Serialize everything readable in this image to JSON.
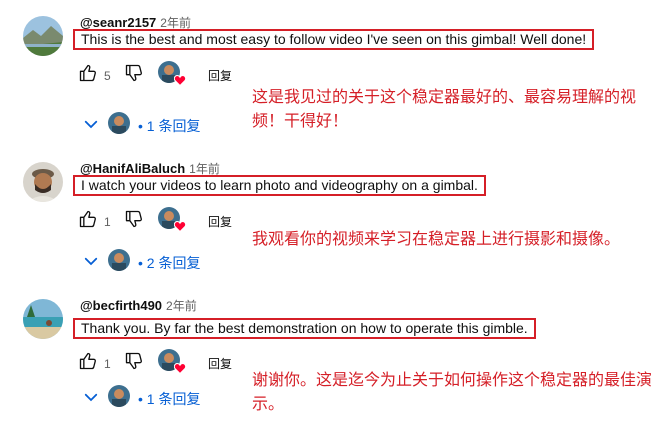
{
  "comments": [
    {
      "author": "@seanr2157",
      "time": "2年前",
      "text": "This is the best and most easy to follow video I've seen on this gimbal! Well done!",
      "likes": "5",
      "reply_label": "回复",
      "replies_label": "1 条回复",
      "translation": "这是我见过的关于这个稳定器最好的、最容易理解的视频！干得好！",
      "avatar_icon": "landscape-avatar-icon"
    },
    {
      "author": "@HanifAliBaluch",
      "time": "1年前",
      "text": "I watch your videos to learn photo and videography on a gimbal.",
      "likes": "1",
      "reply_label": "回复",
      "replies_label": "2 条回复",
      "translation": "我观看你的视频来学习在稳定器上进行摄影和摄像。",
      "avatar_icon": "person-avatar-icon"
    },
    {
      "author": "@becfirth490",
      "time": "2年前",
      "text": "Thank you. By far the best demonstration on how to operate this gimble.",
      "likes": "1",
      "reply_label": "回复",
      "replies_label": "1 条回复",
      "translation": "谢谢你。这是迄今为止关于如何操作这个稳定器的最佳演示。",
      "avatar_icon": "beach-avatar-icon"
    }
  ],
  "colors": {
    "annotation_red": "#d51f27",
    "link_blue": "#065fd4",
    "heart_red": "#ff0033"
  }
}
